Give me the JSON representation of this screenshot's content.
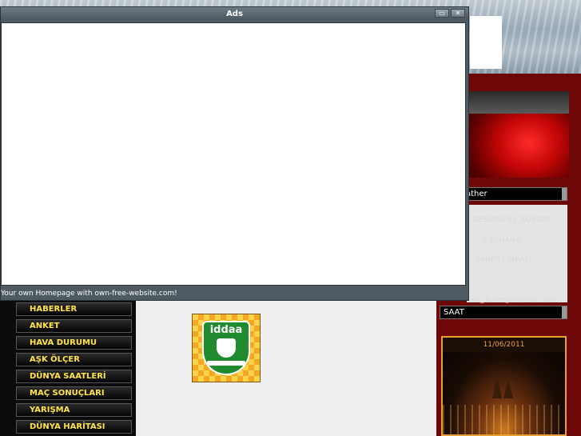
{
  "ads_window": {
    "title": "Ads",
    "minimize_label": "▭",
    "close_label": "✕",
    "status_text": "Your own Homepage with own-free-website.com!"
  },
  "nav": {
    "items": [
      {
        "label": "HABERLER"
      },
      {
        "label": "ANKET"
      },
      {
        "label": "HAVA DURUMU"
      },
      {
        "label": "AŞK ÖLÇER"
      },
      {
        "label": "DÜNYA SAATLERİ"
      },
      {
        "label": "MAÇ SONUÇLARI"
      },
      {
        "label": "YARIŞMA"
      },
      {
        "label": "DÜNYA HARİTASI"
      }
    ]
  },
  "logo": {
    "brand_text": "iddaa"
  },
  "right_col": {
    "weather_label": "ather",
    "panel_lines": [
      "DESIGNE By_ROBBER",
      "a-ESMAN©",
      "TANER CINBASI",
      "ea_Taner@hotmail.com"
    ],
    "saat_label": "SAAT",
    "clock_date": "11/06/2011"
  },
  "colors": {
    "nav_text": "#ffe34a",
    "page_bg": "#7e0b0b",
    "clock_border": "#e8a030"
  }
}
